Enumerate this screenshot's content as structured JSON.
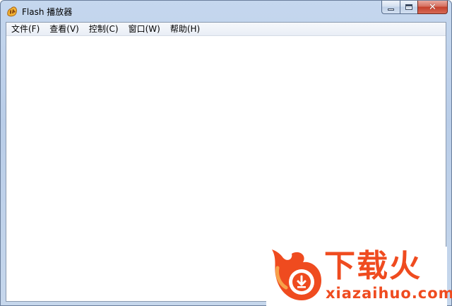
{
  "window": {
    "title": "Flash 播放器",
    "icon": "flash-player-icon"
  },
  "caption": {
    "minimize_icon": "minimize-icon",
    "maximize_icon": "maximize-icon",
    "close_label": "✕"
  },
  "menu": {
    "items": [
      {
        "label": "文件(F)"
      },
      {
        "label": "查看(V)"
      },
      {
        "label": "控制(C)"
      },
      {
        "label": "窗口(W)"
      },
      {
        "label": "帮助(H)"
      }
    ]
  },
  "watermark": {
    "title": "下载火",
    "subtitle": "xiazaihuo.com",
    "color": "#ef4b1f"
  }
}
